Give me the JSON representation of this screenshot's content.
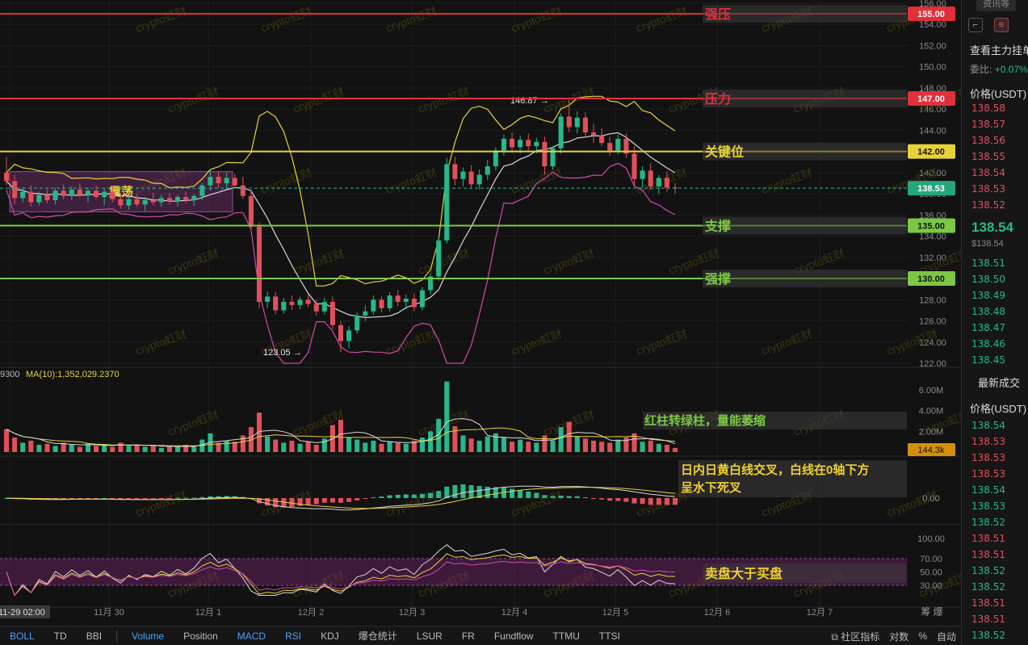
{
  "chart_data": {
    "type": "candlestick",
    "price_axis": {
      "min": 122,
      "max": 156,
      "ticks": [
        156,
        154,
        152,
        150,
        148,
        146,
        144,
        142,
        140,
        138,
        136,
        134,
        132,
        130,
        128,
        126,
        124,
        122
      ]
    },
    "x_axis_labels": [
      "11-29 02:00",
      "11月 30",
      "12月 1",
      "12月 2",
      "12月 3",
      "12月 4",
      "12月 5",
      "12月 6",
      "12月 7"
    ],
    "current_price": "138.53",
    "levels": [
      {
        "name": "强压",
        "value": 155.0,
        "label": "155.00",
        "color": "#e0303a"
      },
      {
        "name": "压力",
        "value": 147.0,
        "label": "147.00",
        "color": "#e0303a"
      },
      {
        "name": "关键位",
        "value": 142.0,
        "label": "142.00",
        "color": "#e8d23a"
      },
      {
        "name": "支撑",
        "value": 135.0,
        "label": "135.00",
        "color": "#7cc844"
      },
      {
        "name": "强撑",
        "value": 130.0,
        "label": "130.00",
        "color": "#7cc844"
      }
    ],
    "annotations": {
      "range_box": "震荡",
      "high_marker": "146.87 →",
      "low_marker": "123.05 →",
      "volume_note": "红柱转绿柱，量能萎缩",
      "macd_note": "日内日黄白线交叉，白线在0轴下方呈水下死叉",
      "rsi_note": "卖盘大于买盘"
    },
    "candles": [
      [
        140,
        141.5,
        138.8,
        139.2
      ],
      [
        139.2,
        139.8,
        137.0,
        137.6
      ],
      [
        137.6,
        138.6,
        137.2,
        138.2
      ],
      [
        138.2,
        138.8,
        136.8,
        137.2
      ],
      [
        137.2,
        138.2,
        136.9,
        137.9
      ],
      [
        137.9,
        138.4,
        137.1,
        137.4
      ],
      [
        137.4,
        138.6,
        137.0,
        138.3
      ],
      [
        138.3,
        138.9,
        137.5,
        137.8
      ],
      [
        137.8,
        138.7,
        137.4,
        138.4
      ],
      [
        138.4,
        139.0,
        137.7,
        137.9
      ],
      [
        137.9,
        138.6,
        137.2,
        138.3
      ],
      [
        138.3,
        138.8,
        137.5,
        137.7
      ],
      [
        137.7,
        138.5,
        136.9,
        138.2
      ],
      [
        138.2,
        138.7,
        137.2,
        137.5
      ],
      [
        137.5,
        138.0,
        136.6,
        136.9
      ],
      [
        136.9,
        137.8,
        136.5,
        137.5
      ],
      [
        137.5,
        138.0,
        136.8,
        137.0
      ],
      [
        137.0,
        137.7,
        136.4,
        137.4
      ],
      [
        137.4,
        138.1,
        136.9,
        137.2
      ],
      [
        137.2,
        137.9,
        136.8,
        137.6
      ],
      [
        137.6,
        138.1,
        137.0,
        137.3
      ],
      [
        137.3,
        137.9,
        136.8,
        137.7
      ],
      [
        137.7,
        138.2,
        137.1,
        137.4
      ],
      [
        137.4,
        138.0,
        136.9,
        137.8
      ],
      [
        137.8,
        139.0,
        137.4,
        138.8
      ],
      [
        138.8,
        140.2,
        138.3,
        139.6
      ],
      [
        139.6,
        140.1,
        138.6,
        139.0
      ],
      [
        139.0,
        140.0,
        138.4,
        139.5
      ],
      [
        139.5,
        139.9,
        138.5,
        138.8
      ],
      [
        138.8,
        139.6,
        137.5,
        137.8
      ],
      [
        137.8,
        138.4,
        134.5,
        134.9
      ],
      [
        134.9,
        135.3,
        127.2,
        127.8
      ],
      [
        127.8,
        128.8,
        127.2,
        128.3
      ],
      [
        128.3,
        128.7,
        126.6,
        127.0
      ],
      [
        127.0,
        128.2,
        126.7,
        127.8
      ],
      [
        127.8,
        128.4,
        127.0,
        127.5
      ],
      [
        127.5,
        128.3,
        127.1,
        128.0
      ],
      [
        128.0,
        128.6,
        127.3,
        127.6
      ],
      [
        127.6,
        128.0,
        126.5,
        126.9
      ],
      [
        126.9,
        128.2,
        126.6,
        127.8
      ],
      [
        127.8,
        128.3,
        125.2,
        125.6
      ],
      [
        125.6,
        126.0,
        123.05,
        124.1
      ],
      [
        124.1,
        125.5,
        123.4,
        125.1
      ],
      [
        125.1,
        126.8,
        124.8,
        126.5
      ],
      [
        126.5,
        127.5,
        126.0,
        126.9
      ],
      [
        126.9,
        128.4,
        126.6,
        128.0
      ],
      [
        128.0,
        128.3,
        126.8,
        127.2
      ],
      [
        127.2,
        128.7,
        126.9,
        128.4
      ],
      [
        128.4,
        128.9,
        127.4,
        127.8
      ],
      [
        127.8,
        128.5,
        127.1,
        128.1
      ],
      [
        128.1,
        128.6,
        126.9,
        127.3
      ],
      [
        127.3,
        129.2,
        127.0,
        128.9
      ],
      [
        128.9,
        130.5,
        128.5,
        130.2
      ],
      [
        130.2,
        134.0,
        129.8,
        133.6
      ],
      [
        133.6,
        141.4,
        133.3,
        140.8
      ],
      [
        140.8,
        141.5,
        138.8,
        139.4
      ],
      [
        139.4,
        140.5,
        138.7,
        140.1
      ],
      [
        140.1,
        140.7,
        138.5,
        138.9
      ],
      [
        138.9,
        140.3,
        138.4,
        139.8
      ],
      [
        139.8,
        141.2,
        139.3,
        140.6
      ],
      [
        140.6,
        142.4,
        140.2,
        142.1
      ],
      [
        142.1,
        143.6,
        141.6,
        143.2
      ],
      [
        143.2,
        143.8,
        141.9,
        142.4
      ],
      [
        142.4,
        143.5,
        141.8,
        143.1
      ],
      [
        143.1,
        143.7,
        142.0,
        142.5
      ],
      [
        142.5,
        143.3,
        141.8,
        142.9
      ],
      [
        142.9,
        143.4,
        139.8,
        140.6
      ],
      [
        140.6,
        142.5,
        140.3,
        142.3
      ],
      [
        142.3,
        145.6,
        141.8,
        145.3
      ],
      [
        145.3,
        146.87,
        143.8,
        144.3
      ],
      [
        144.3,
        145.8,
        143.7,
        145.2
      ],
      [
        145.2,
        145.7,
        143.4,
        143.8
      ],
      [
        143.8,
        144.6,
        142.8,
        143.5
      ],
      [
        143.5,
        144.2,
        142.5,
        142.8
      ],
      [
        142.8,
        143.4,
        141.6,
        142.1
      ],
      [
        142.1,
        143.6,
        141.7,
        143.2
      ],
      [
        143.2,
        143.7,
        141.4,
        141.8
      ],
      [
        141.8,
        142.5,
        138.8,
        139.4
      ],
      [
        139.4,
        140.6,
        138.6,
        140.2
      ],
      [
        140.2,
        140.9,
        138.4,
        138.7
      ],
      [
        138.7,
        139.8,
        138.0,
        139.5
      ],
      [
        139.5,
        140.1,
        138.2,
        138.6
      ],
      [
        138.6,
        139.0,
        138.0,
        138.53
      ]
    ],
    "volume_axis": {
      "ticks": [
        "6.00M",
        "4.00M",
        "2.00M"
      ],
      "current": "144.3k"
    },
    "volume_ma_label": "9300  MA(10):1,352,029.2370",
    "volumes": [
      2.2,
      1.4,
      0.9,
      1.1,
      0.7,
      0.8,
      0.6,
      0.9,
      0.7,
      0.5,
      0.8,
      0.6,
      0.7,
      0.5,
      0.9,
      0.6,
      0.7,
      0.5,
      0.6,
      0.4,
      0.6,
      0.5,
      0.7,
      0.5,
      1.2,
      1.8,
      0.9,
      1.1,
      1.0,
      1.6,
      2.4,
      3.8,
      1.5,
      1.2,
      0.9,
      1.1,
      0.8,
      1.0,
      0.7,
      1.3,
      2.6,
      3.1,
      1.4,
      1.2,
      0.9,
      1.1,
      0.8,
      1.0,
      0.9,
      0.8,
      1.1,
      1.4,
      2.0,
      3.2,
      6.8,
      2.5,
      1.6,
      1.3,
      1.1,
      1.5,
      1.8,
      1.4,
      1.0,
      1.2,
      1.0,
      0.9,
      1.6,
      1.1,
      2.4,
      2.9,
      1.5,
      1.3,
      1.1,
      1.0,
      0.9,
      1.2,
      1.4,
      1.8,
      1.0,
      1.1,
      0.8,
      0.7,
      0.4
    ],
    "macd_axis": {
      "zero": "0.00"
    },
    "rsi_axis": {
      "ticks": [
        "100.00",
        "70.00",
        "50.00",
        "30.00"
      ]
    }
  },
  "sidebar": {
    "top_tab": "资讯等",
    "title": "查看主力挂单",
    "ratio_label": "委比:",
    "ratio_value": "+0.07%",
    "price_header": "价格(USDT)",
    "asks": [
      "138.58",
      "138.57",
      "138.56",
      "138.55",
      "138.54",
      "138.53",
      "138.52"
    ],
    "last_price": "138.54",
    "last_price_usd": "$138.54",
    "bids": [
      "138.51",
      "138.50",
      "138.49",
      "138.48",
      "138.47",
      "138.46",
      "138.45"
    ],
    "trades_title": "最新成交",
    "trades_header": "价格(USDT)",
    "trades": [
      {
        "p": "138.54",
        "c": "green"
      },
      {
        "p": "138.53",
        "c": "red"
      },
      {
        "p": "138.53",
        "c": "red"
      },
      {
        "p": "138.53",
        "c": "red"
      },
      {
        "p": "138.54",
        "c": "green"
      },
      {
        "p": "138.53",
        "c": "green"
      },
      {
        "p": "138.52",
        "c": "green"
      },
      {
        "p": "138.51",
        "c": "red"
      },
      {
        "p": "138.51",
        "c": "red"
      },
      {
        "p": "138.52",
        "c": "green"
      },
      {
        "p": "138.52",
        "c": "green"
      },
      {
        "p": "138.51",
        "c": "red"
      },
      {
        "p": "138.51",
        "c": "red"
      },
      {
        "p": "138.52",
        "c": "green"
      }
    ]
  },
  "toolbar": {
    "items": [
      "BOLL",
      "TD",
      "BBI",
      "Volume",
      "Position",
      "MACD",
      "RSI",
      "KDJ",
      "爆仓统计",
      "LSUR",
      "FR",
      "Fundflow",
      "TTMU",
      "TTSI"
    ],
    "active": [
      "BOLL",
      "Volume",
      "MACD",
      "RSI"
    ],
    "community": "社区指标",
    "log": "对数",
    "percent": "%",
    "auto": "自动"
  },
  "watermark": "crypto虹财",
  "colors": {
    "up": "#26b88a",
    "down": "#e0505b",
    "yellow": "#e8d23a",
    "white": "#d8d8d8",
    "pink": "#d04ab0"
  }
}
